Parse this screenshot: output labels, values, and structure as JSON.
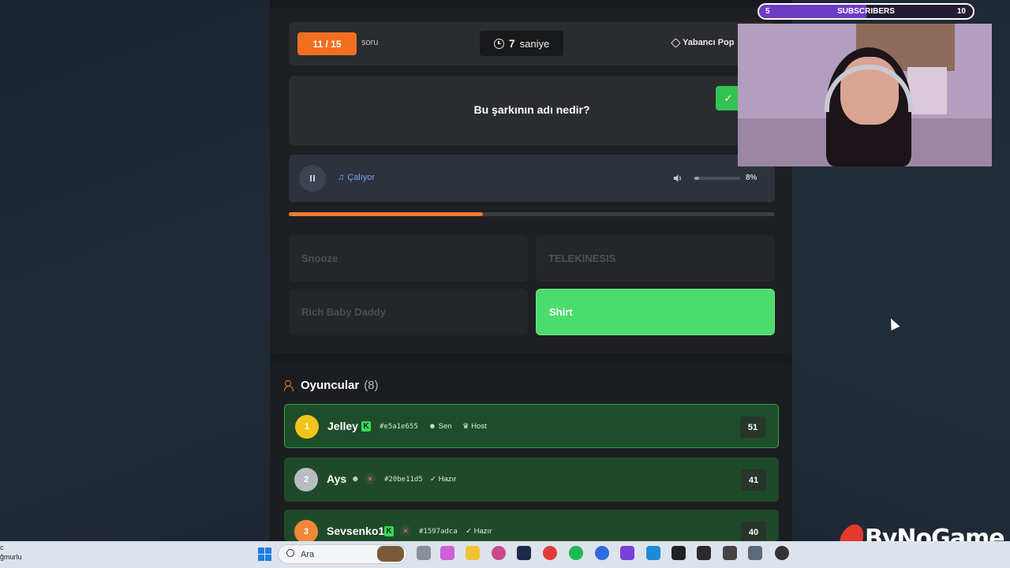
{
  "quiz": {
    "question_counter": "11 / 15",
    "counter_suffix": "soru",
    "timer_value": "7",
    "timer_unit": "saniye",
    "category": "Yabancı Pop",
    "question": "Bu şarkının adı nedir?",
    "player_status": "Çalıyor",
    "volume_percent": "8%",
    "volume_level": 0.08,
    "progress": 0.4,
    "answers": [
      {
        "label": "Snooze",
        "correct": false
      },
      {
        "label": "TELEKINESIS",
        "correct": false
      },
      {
        "label": "Rich Baby Daddy",
        "correct": false
      },
      {
        "label": "Shirt",
        "correct": true
      }
    ]
  },
  "players": {
    "title": "Oyuncular",
    "count": "(8)",
    "rows": [
      {
        "rank": "1",
        "name": "Jelley",
        "id": "#e5a1e655",
        "tag1": "Sen",
        "tag2": "Host",
        "score": "51",
        "rank_color": "#f2c31b"
      },
      {
        "rank": "2",
        "name": "Ays",
        "id": "#20be11d5",
        "tag1": "Hazır",
        "score": "41",
        "rank_color": "#b9bcc1"
      },
      {
        "rank": "3",
        "name": "Sevsenko1",
        "id": "#1597adca",
        "tag1": "Hazır",
        "score": "40",
        "rank_color": "#f0883a"
      }
    ]
  },
  "stream": {
    "sub_current": "5",
    "sub_label": "SUBSCRIBERS",
    "sub_goal": "10",
    "sub_progress": 0.5,
    "brand": "ByNoGame"
  },
  "taskbar": {
    "left_line1": "c",
    "left_line2": "ğmurlu",
    "search_placeholder": "Ara"
  }
}
